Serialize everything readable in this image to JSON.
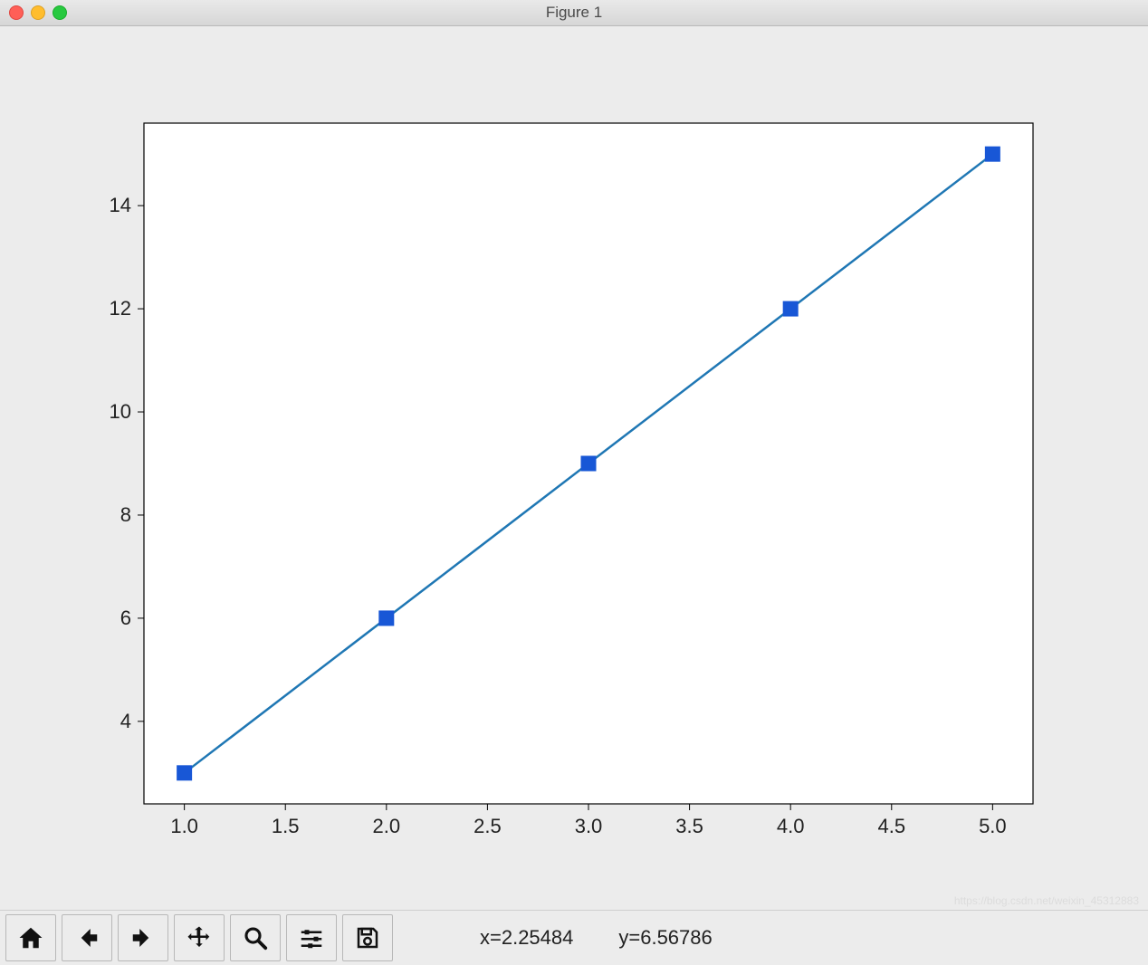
{
  "window": {
    "title": "Figure 1"
  },
  "toolbar": {
    "home": "home-icon",
    "back": "arrow-left-icon",
    "fwd": "arrow-right-icon",
    "pan": "move-icon",
    "zoom": "magnify-icon",
    "config": "sliders-icon",
    "save": "floppy-icon"
  },
  "status": {
    "x_label": "x=2.25484",
    "y_label": "y=6.56786"
  },
  "chart_data": {
    "type": "line",
    "x": [
      1,
      2,
      3,
      4,
      5
    ],
    "y": [
      3,
      6,
      9,
      12,
      15
    ],
    "marker": "square",
    "line_color": "#1f77b4",
    "marker_color": "#1857d6",
    "xlim": [
      0.8,
      5.2
    ],
    "ylim": [
      2.4,
      15.6
    ],
    "xticks": [
      1.0,
      1.5,
      2.0,
      2.5,
      3.0,
      3.5,
      4.0,
      4.5,
      5.0
    ],
    "yticks": [
      4,
      6,
      8,
      10,
      12,
      14
    ],
    "xtick_labels": [
      "1.0",
      "1.5",
      "2.0",
      "2.5",
      "3.0",
      "3.5",
      "4.0",
      "4.5",
      "5.0"
    ],
    "ytick_labels": [
      "4",
      "6",
      "8",
      "10",
      "12",
      "14"
    ],
    "title": "",
    "xlabel": "",
    "ylabel": ""
  }
}
